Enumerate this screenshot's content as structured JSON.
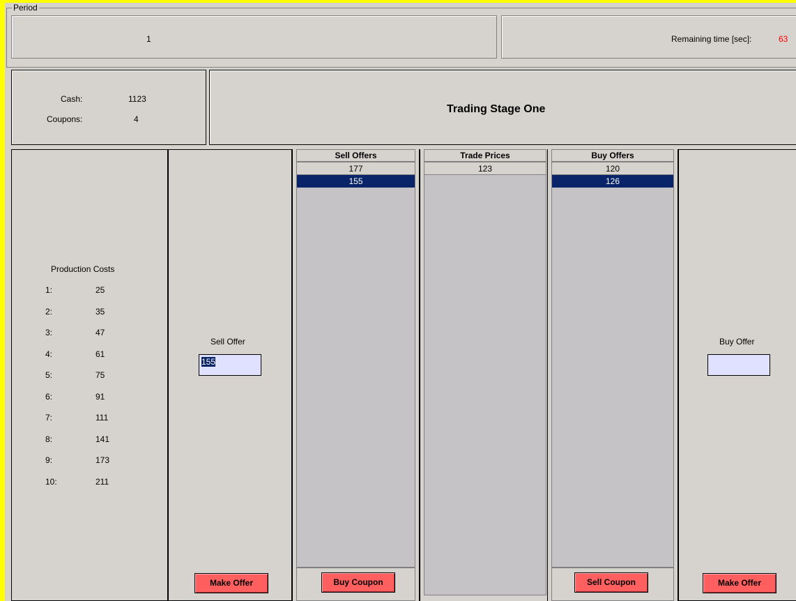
{
  "period": {
    "label": "Period",
    "value": "1"
  },
  "timer": {
    "label": "Remaining time [sec]:",
    "value": "63",
    "value_color": "#ff0000"
  },
  "account": {
    "cash_label": "Cash:",
    "cash_value": "1123",
    "coupons_label": "Coupons:",
    "coupons_value": "4"
  },
  "stage_title": "Trading Stage One",
  "production_costs": {
    "title": "Production Costs",
    "items": [
      {
        "index": "1:",
        "value": "25"
      },
      {
        "index": "2:",
        "value": "35"
      },
      {
        "index": "3:",
        "value": "47"
      },
      {
        "index": "4:",
        "value": "61"
      },
      {
        "index": "5:",
        "value": "75"
      },
      {
        "index": "6:",
        "value": "91"
      },
      {
        "index": "7:",
        "value": "111"
      },
      {
        "index": "8:",
        "value": "141"
      },
      {
        "index": "9:",
        "value": "173"
      },
      {
        "index": "10:",
        "value": "211"
      }
    ]
  },
  "sell_offer": {
    "label": "Sell Offer",
    "value": "155",
    "button": "Make Offer"
  },
  "sell_offers": {
    "header": "Sell Offers",
    "items": [
      "177",
      "155"
    ],
    "selected_index": 1,
    "button": "Buy Coupon"
  },
  "trade_prices": {
    "header": "Trade Prices",
    "items": [
      "123"
    ]
  },
  "buy_offers": {
    "header": "Buy Offers",
    "items": [
      "120",
      "126"
    ],
    "selected_index": 1,
    "button": "Sell Coupon"
  },
  "buy_offer": {
    "label": "Buy Offer",
    "value": "",
    "button": "Make Offer"
  },
  "colors": {
    "frame": "#ffff00",
    "panel": "#d6d3ce",
    "list_bg": "#c6c3c6",
    "selection": "#0a246a",
    "button": "#ff5f5f",
    "input_bg": "#e0e0ff"
  }
}
